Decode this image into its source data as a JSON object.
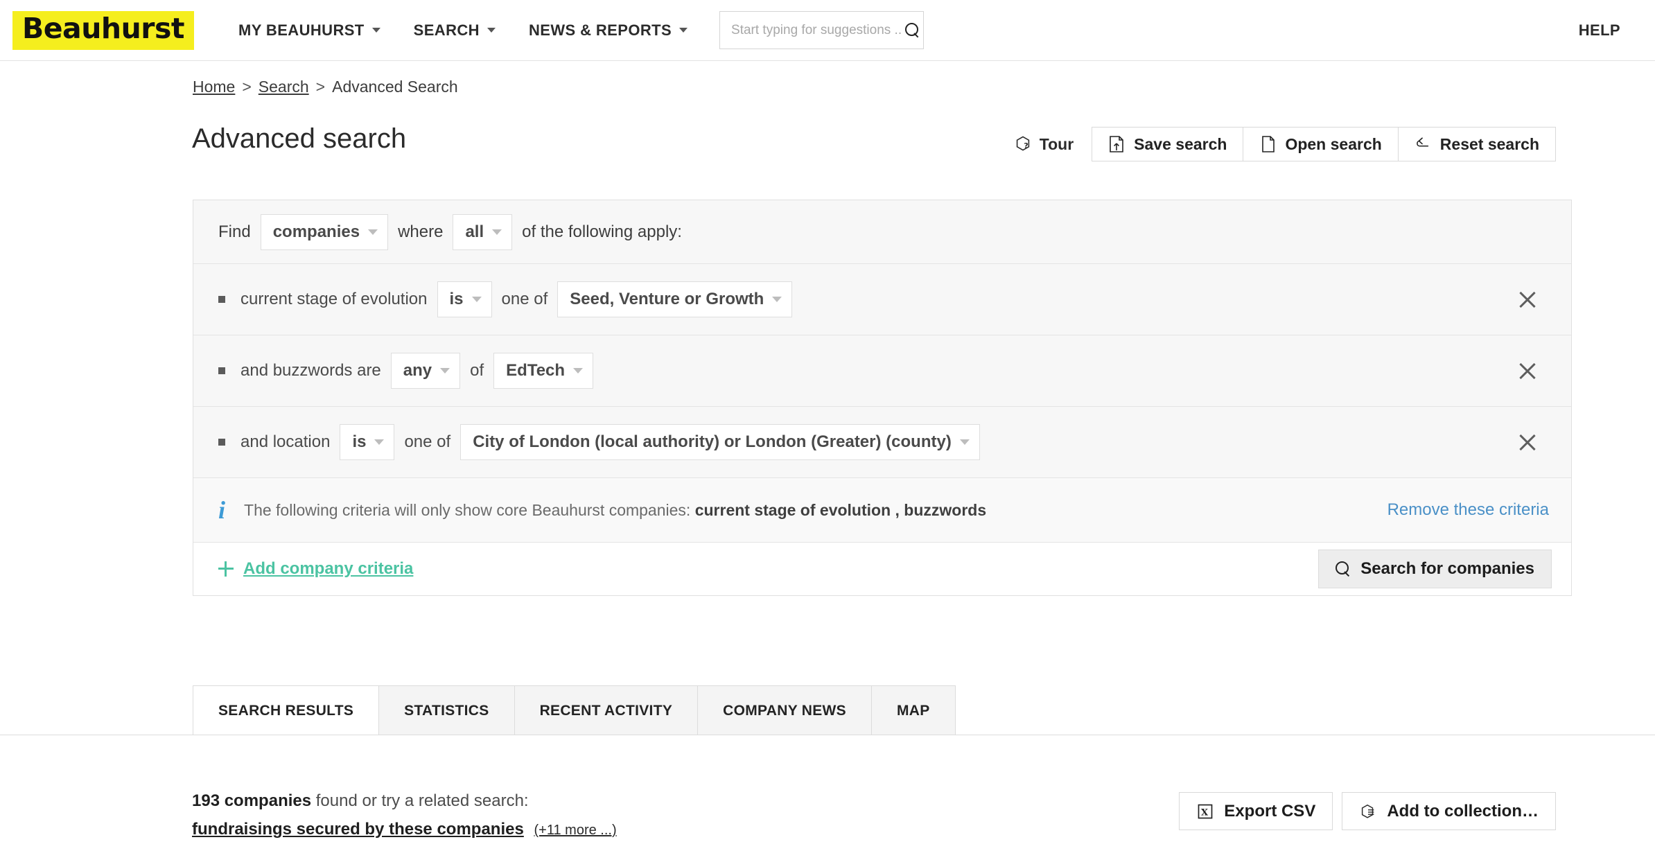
{
  "header": {
    "logo_text": "Beauhurst",
    "nav": [
      {
        "label": "MY BEAUHURST",
        "has_caret": true
      },
      {
        "label": "SEARCH",
        "has_caret": true
      },
      {
        "label": "NEWS & REPORTS",
        "has_caret": true
      }
    ],
    "search_placeholder": "Start typing for suggestions ...",
    "search_value": "",
    "help_label": "HELP",
    "logo_bg": "#f5ee1e"
  },
  "breadcrumb": {
    "home": "Home",
    "search": "Search",
    "current": "Advanced Search",
    "separator": ">"
  },
  "page": {
    "title": "Advanced search",
    "tour_label": "Tour",
    "save_label": "Save search",
    "open_label": "Open search",
    "reset_label": "Reset search"
  },
  "builder": {
    "find_label": "Find",
    "entity_value": "companies",
    "where_label": "where",
    "match_value": "all",
    "apply_label": "of the following apply:",
    "criteria": [
      {
        "field": "current stage of evolution",
        "operator": "is",
        "connector": "one of",
        "value": "Seed, Venture or Growth"
      },
      {
        "field": "and buzzwords are",
        "operator": "any",
        "connector": "of",
        "value": "EdTech"
      },
      {
        "field": "and location",
        "operator": "is",
        "connector": "one of",
        "value": "City of London (local authority) or London (Greater) (county)"
      }
    ],
    "notice": {
      "icon": "info-icon",
      "text_prefix": "The following criteria will only show core Beauhurst companies:",
      "fields": "current stage of evolution , buzzwords",
      "remove_label": "Remove these criteria",
      "remove_color": "#4a90c7"
    },
    "add_label": "Add company criteria",
    "add_color": "#4bc3a2",
    "search_button_label": "Search for companies"
  },
  "tabs": [
    {
      "label": "SEARCH RESULTS",
      "active": true
    },
    {
      "label": "STATISTICS",
      "active": false
    },
    {
      "label": "RECENT ACTIVITY",
      "active": false
    },
    {
      "label": "COMPANY NEWS",
      "active": false
    },
    {
      "label": "MAP",
      "active": false
    }
  ],
  "results": {
    "count_text": "193 companies",
    "found_text": "found or try a related search:",
    "related_link": "fundraisings secured by these companies",
    "more_link": "(+11 more ...)",
    "export_label": "Export CSV",
    "collection_label": "Add to collection…"
  }
}
